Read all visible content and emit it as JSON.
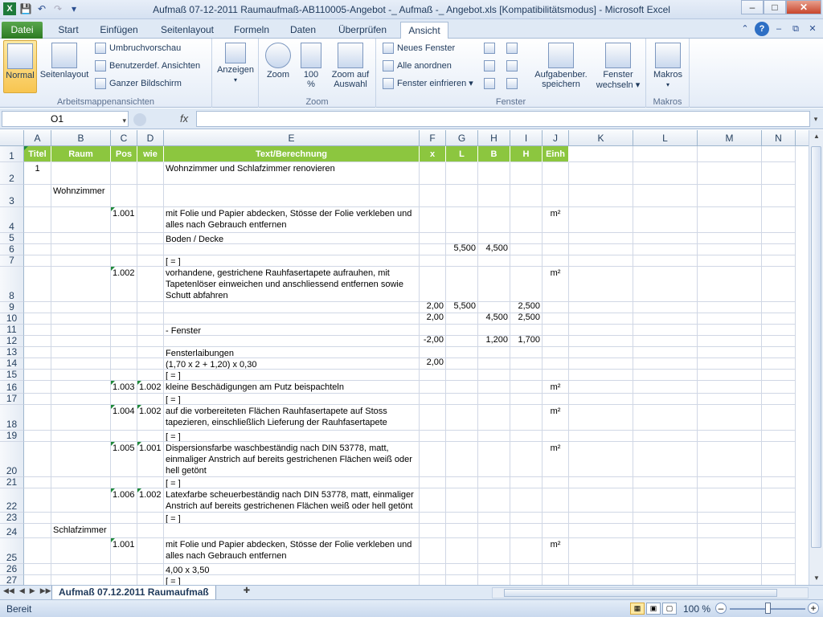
{
  "window": {
    "title": "Aufmaß 07-12-2011 Raumaufmaß-AB110005-Angebot -_ Aufmaß -_ Angebot.xls  [Kompatibilitätsmodus] - Microsoft Excel"
  },
  "qat": {
    "save": "save-icon",
    "undo": "undo-icon",
    "redo": "redo-icon",
    "customize": "customize-icon"
  },
  "tabs": [
    {
      "label": "Datei"
    },
    {
      "label": "Start"
    },
    {
      "label": "Einfügen"
    },
    {
      "label": "Seitenlayout"
    },
    {
      "label": "Formeln"
    },
    {
      "label": "Daten"
    },
    {
      "label": "Überprüfen"
    },
    {
      "label": "Ansicht"
    }
  ],
  "ribbon": {
    "groups": {
      "arbeitsmappen": "Arbeitsmappenansichten",
      "zoom": "Zoom",
      "fenster": "Fenster",
      "makros": "Makros"
    },
    "normal": "Normal",
    "seitenlayout": "Seitenlayout",
    "umbruch": "Umbruchvorschau",
    "benutzerdef": "Benutzerdef. Ansichten",
    "ganzer": "Ganzer Bildschirm",
    "anzeigen": "Anzeigen",
    "zoom": "Zoom",
    "zoom100_line1": "100",
    "zoom100_line2": "%",
    "fenster_einfrieren_big_l1": "Zoom auf",
    "fenster_einfrieren_big_l2": "Auswahl",
    "neues_fenster": "Neues Fenster",
    "alle_anordnen": "Alle anordnen",
    "fenster_einfrieren": "Fenster einfrieren",
    "aufgaben_l1": "Aufgabenber.",
    "aufgaben_l2": "speichern",
    "wechseln_l1": "Fenster",
    "wechseln_l2": "wechseln",
    "makros": "Makros"
  },
  "formulabar": {
    "namebox": "O1",
    "fx": "fx",
    "content": ""
  },
  "columns": [
    "A",
    "B",
    "C",
    "D",
    "E",
    "F",
    "G",
    "H",
    "I",
    "J",
    "K",
    "L",
    "M",
    "N"
  ],
  "header": {
    "A": "Titel",
    "B": "Raum",
    "C": "Pos",
    "D": "wie",
    "E": "Text/Berechnung",
    "F": "x",
    "G": "L",
    "H": "B",
    "I": "H",
    "J": "Einh"
  },
  "rows": [
    {
      "n": "1",
      "h": 20,
      "hdr": true
    },
    {
      "n": "2",
      "h": 28,
      "A": "1",
      "E": "Wohnzimmer und Schlafzimmer renovieren"
    },
    {
      "n": "3",
      "h": 28,
      "B": "Wohnzimmer"
    },
    {
      "n": "4",
      "h": 32,
      "C": "1.001",
      "E": "mit Folie und Papier abdecken, Stösse der Folie verkleben und\nalles nach Gebrauch entfernen",
      "J": "m²"
    },
    {
      "n": "5",
      "h": 14,
      "E": "Boden / Decke"
    },
    {
      "n": "6",
      "h": 14,
      "G": "5,500",
      "H": "4,500"
    },
    {
      "n": "7",
      "h": 14,
      "E": "[ = ]"
    },
    {
      "n": "8",
      "h": 44,
      "C": "1.002",
      "E": "vorhandene, gestrichene Rauhfasertapete aufrauhen, mit\nTapetenlöser einweichen und anschliessend entfernen sowie\nSchutt abfahren",
      "J": "m²"
    },
    {
      "n": "9",
      "h": 14,
      "F": "2,00",
      "G": "5,500",
      "I": "2,500"
    },
    {
      "n": "10",
      "h": 14,
      "F": "2,00",
      "H": "4,500",
      "I": "2,500"
    },
    {
      "n": "11",
      "h": 14,
      "E": "- Fenster"
    },
    {
      "n": "12",
      "h": 14,
      "F": "-2,00",
      "H": "1,200",
      "I": "1,700"
    },
    {
      "n": "13",
      "h": 14,
      "E": "Fensterlaibungen"
    },
    {
      "n": "14",
      "h": 14,
      "E": "(1,70 x 2 + 1,20) x 0,30",
      "F": "2,00"
    },
    {
      "n": "15",
      "h": 14,
      "E": "[ = ]"
    },
    {
      "n": "16",
      "h": 16,
      "C": "1.003",
      "D": "1.002",
      "E": "kleine Beschädigungen am Putz beispachteln",
      "J": "m²"
    },
    {
      "n": "17",
      "h": 14,
      "E": "[ = ]"
    },
    {
      "n": "18",
      "h": 32,
      "C": "1.004",
      "D": "1.002",
      "E": "auf die vorbereiteten Flächen Rauhfasertapete auf Stoss\ntapezieren, einschließlich Lieferung der Rauhfasertapete",
      "J": "m²"
    },
    {
      "n": "19",
      "h": 14,
      "E": "[ = ]"
    },
    {
      "n": "20",
      "h": 44,
      "C": "1.005",
      "D": "1.001",
      "E": "Dispersionsfarbe waschbeständig nach DIN 53778, matt,\neinmaliger Anstrich auf bereits gestrichenen Flächen weiß oder\nhell getönt",
      "J": "m²"
    },
    {
      "n": "21",
      "h": 14,
      "E": "[ = ]"
    },
    {
      "n": "22",
      "h": 30,
      "C": "1.006",
      "D": "1.002",
      "E": "Latexfarbe scheuerbeständig nach DIN 53778, matt, einmaliger\nAnstrich auf bereits gestrichenen Flächen weiß oder hell getönt"
    },
    {
      "n": "23",
      "h": 14,
      "E": "[ = ]"
    },
    {
      "n": "24",
      "h": 18,
      "B": "Schlafzimmer"
    },
    {
      "n": "25",
      "h": 32,
      "C": "1.001",
      "E": "mit Folie und Papier abdecken, Stösse der Folie verkleben und\nalles nach Gebrauch entfernen",
      "J": "m²"
    },
    {
      "n": "26",
      "h": 14,
      "E": "4,00 x 3,50"
    },
    {
      "n": "27",
      "h": 14,
      "E": "[ = ]"
    }
  ],
  "sheet": {
    "tab": "Aufmaß 07.12.2011 Raumaufmaß"
  },
  "status": {
    "ready": "Bereit",
    "zoom": "100 %"
  }
}
